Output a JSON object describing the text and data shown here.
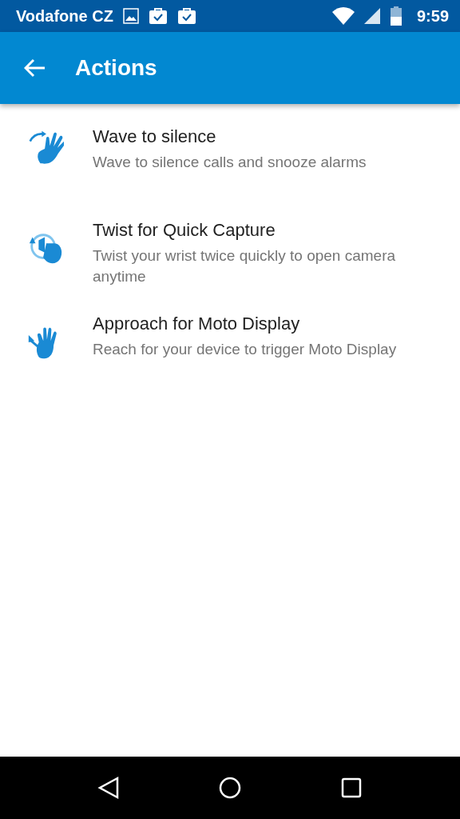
{
  "status_bar": {
    "carrier": "Vodafone CZ",
    "time": "9:59"
  },
  "toolbar": {
    "title": "Actions"
  },
  "actions": [
    {
      "kind": "wave",
      "title": "Wave to silence",
      "subtitle": "Wave to silence calls and snooze alarms"
    },
    {
      "kind": "twist",
      "title": "Twist for Quick Capture",
      "subtitle": "Twist your wrist twice quickly to open camera anytime"
    },
    {
      "kind": "approach",
      "title": "Approach for Moto Display",
      "subtitle": "Reach for your device to trigger Moto Display"
    }
  ]
}
